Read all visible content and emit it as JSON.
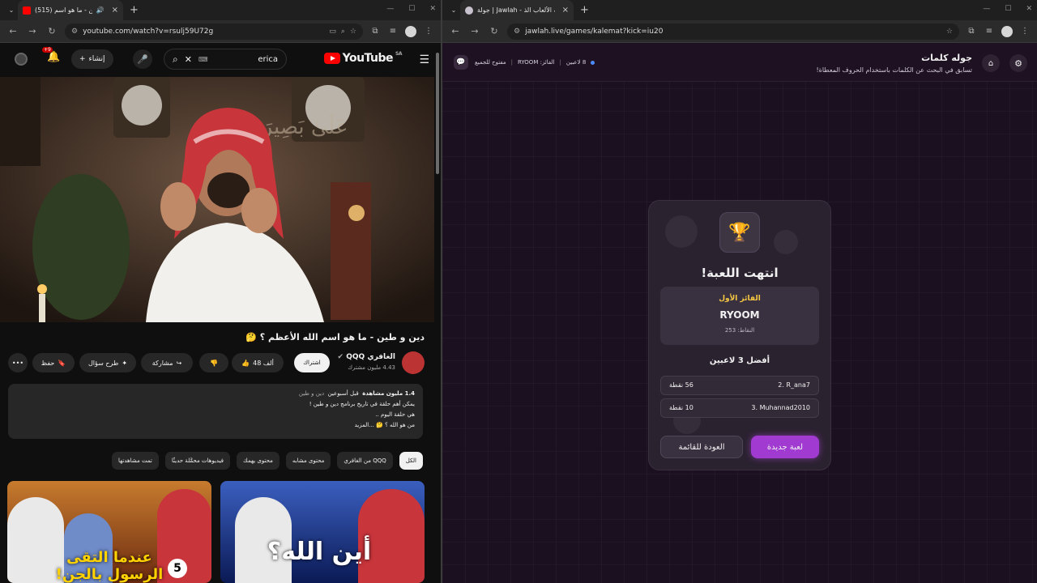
{
  "left_window": {
    "tab": {
      "title": "(515) دين وطين - ما هو اسم",
      "audio_icon": "speaker-icon"
    },
    "url": "youtube.com/watch?v=rsulj59U72g",
    "header": {
      "logo_text": "YouTube",
      "region": "SA",
      "search_query": "erica",
      "create_label": "إنشاء",
      "notif_badge": "+9"
    },
    "video": {
      "title": "دين و طين - ما هو اسم الله الأعظم ؟ 🤔",
      "channel_name": "الغافري QQQ",
      "subscribers": "4.43 مليون مشترك",
      "subscribe_label": "اشتراك",
      "likes": "48 ألف",
      "share_label": "مشاركة",
      "ask_label": "طرح سؤال",
      "save_label": "حفظ",
      "more_label": "•••"
    },
    "description": {
      "views": "1.4 مليون مشاهدة",
      "age": "قبل أسبوعين",
      "tags": "دين و طين",
      "line2": "يمكن أهم حلقة في تاريخ برنامج دين و طين !",
      "line3": "هي حلقة اليوم ..",
      "line4": "من هو الله ؟ 🤔 ...المزيد"
    },
    "chips": [
      "الكل",
      "من الغافري QQQ",
      "محتوى مشابه",
      "محتوى يهمك",
      "فيديوهات محمَّلة حديثًا",
      "تمت مشاهدتها"
    ],
    "thumbnails": [
      {
        "text": "عندما التقى الرسول بالجن!",
        "episode": "5"
      },
      {
        "text": "أين الله؟"
      }
    ]
  },
  "right_window": {
    "tab": {
      "title": "جولة | Jawlah - منصة الألعاب الذ"
    },
    "url": "jawlah.live/games/kalemat?kick=iu20",
    "header": {
      "title": "جوله كلمات",
      "subtitle": "تسابق في البحث عن الكلمات باستخدام الحروف المعطاة!",
      "players": "8 لاعبين",
      "winner_meta": "الفائز: RYOOM",
      "open_label": "مفتوح للجميع"
    },
    "result": {
      "title": "انتهت اللعبة!",
      "winner_label": "الفائز الأول",
      "winner_name": "RYOOM",
      "winner_points": "النقاط: 253",
      "top_label": "أفضل 3 لاعبين",
      "leaderboard": [
        {
          "name": "2. R_ana7",
          "score": "56 نقطة"
        },
        {
          "name": "3. Muhannad2010",
          "score": "10 نقطة"
        }
      ],
      "new_game_label": "لعبة جديدة",
      "back_label": "العودة للقائمة"
    }
  },
  "colors": {
    "yt_red": "#ff0000",
    "accent_purple": "#a03ad1",
    "gold": "#f5c842"
  }
}
